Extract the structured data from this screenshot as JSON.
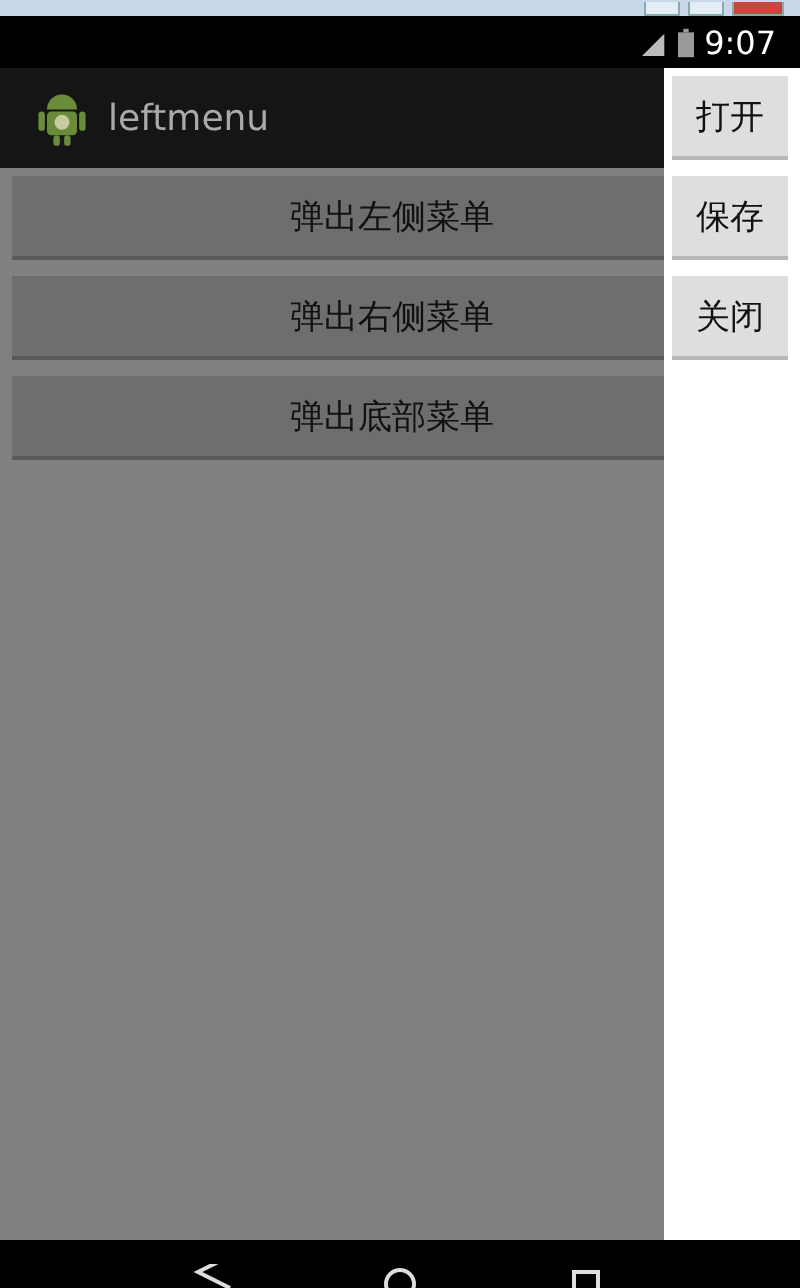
{
  "status_bar": {
    "time": "9:07"
  },
  "app_bar": {
    "title": "leftmenu"
  },
  "main_buttons": [
    {
      "label": "弹出左侧菜单"
    },
    {
      "label": "弹出右侧菜单"
    },
    {
      "label": "弹出底部菜单"
    }
  ],
  "right_menu": [
    {
      "label": "打开"
    },
    {
      "label": "保存"
    },
    {
      "label": "关闭"
    }
  ]
}
